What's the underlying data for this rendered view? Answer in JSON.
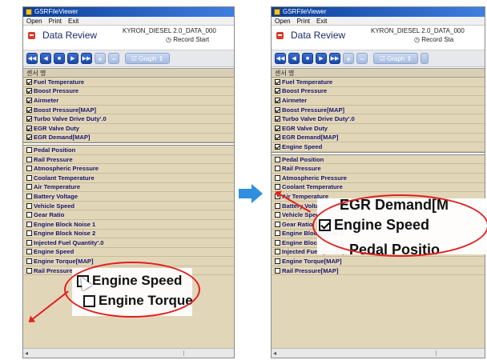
{
  "left": {
    "app_title": "GSRFileViewer",
    "menu": [
      "Open",
      "Print",
      "Exit"
    ],
    "panel_title": "Data Review",
    "vehicle": "KYRON_DIESEL 2.0_DATA_000",
    "record_label": "Record Start",
    "graph_label": "Graph",
    "list_header": "센서 명",
    "checked_items": [
      "Fuel Temperature",
      "Boost Pressure",
      "Airmeter",
      "Boost Pressure[MAP]",
      "Turbo Valve Drive Duty'.0",
      "EGR Valve Duty",
      "EGR Demand[MAP]"
    ],
    "unchecked_items": [
      "Pedal Position",
      "Rail Pressure",
      "Atmospheric Pressure",
      "Coolant Temperature",
      "Air Temperature",
      "Battery Voltage",
      "Vehicle Speed",
      "Gear Ratio",
      "Engine Block Noise 1",
      "Engine Block Noise 2",
      "Injected Fuel Quantity'.0",
      "Engine Speed",
      "Engine Torque[MAP]",
      "Rail Pressure[MAP]"
    ],
    "zoom_line1": "Engine Speed",
    "zoom_line2": "Engine Torque"
  },
  "right": {
    "app_title": "GSRFileViewer",
    "menu": [
      "Open",
      "Print",
      "Exit"
    ],
    "panel_title": "Data Review",
    "vehicle": "KYRON_DIESEL 2.0_DATA_000",
    "record_label": "Record Sta",
    "graph_label": "Graph",
    "list_header": "센서 명",
    "checked_items": [
      "Fuel Temperature",
      "Boost Pressure",
      "Airmeter",
      "Boost Pressure[MAP]",
      "Turbo Valve Drive Duty'.0",
      "EGR Valve Duty",
      "EGR Demand[MAP]",
      "Engine Speed"
    ],
    "unchecked_items": [
      "Pedal Position",
      "Rail Pressure",
      "Atmospheric Pressure",
      "Coolant Temperature",
      "Air Temperature",
      "Battery Voltage",
      "Vehicle Speed",
      "Gear Ratio",
      "Engine Block Noise 1",
      "Engine Block Noise 2",
      "Injected Fuel Quantity'.0",
      "Engine Torque[MAP]",
      "Rail Pressure[MAP]"
    ],
    "zoom_line1": "EGR Demand[M",
    "zoom_line2": "Engine Speed",
    "zoom_line3": "Pedal Positio"
  },
  "colors": {
    "accent": "#2e8fe0",
    "highlight": "#e02020",
    "list_bg": "#e2d6b9"
  }
}
